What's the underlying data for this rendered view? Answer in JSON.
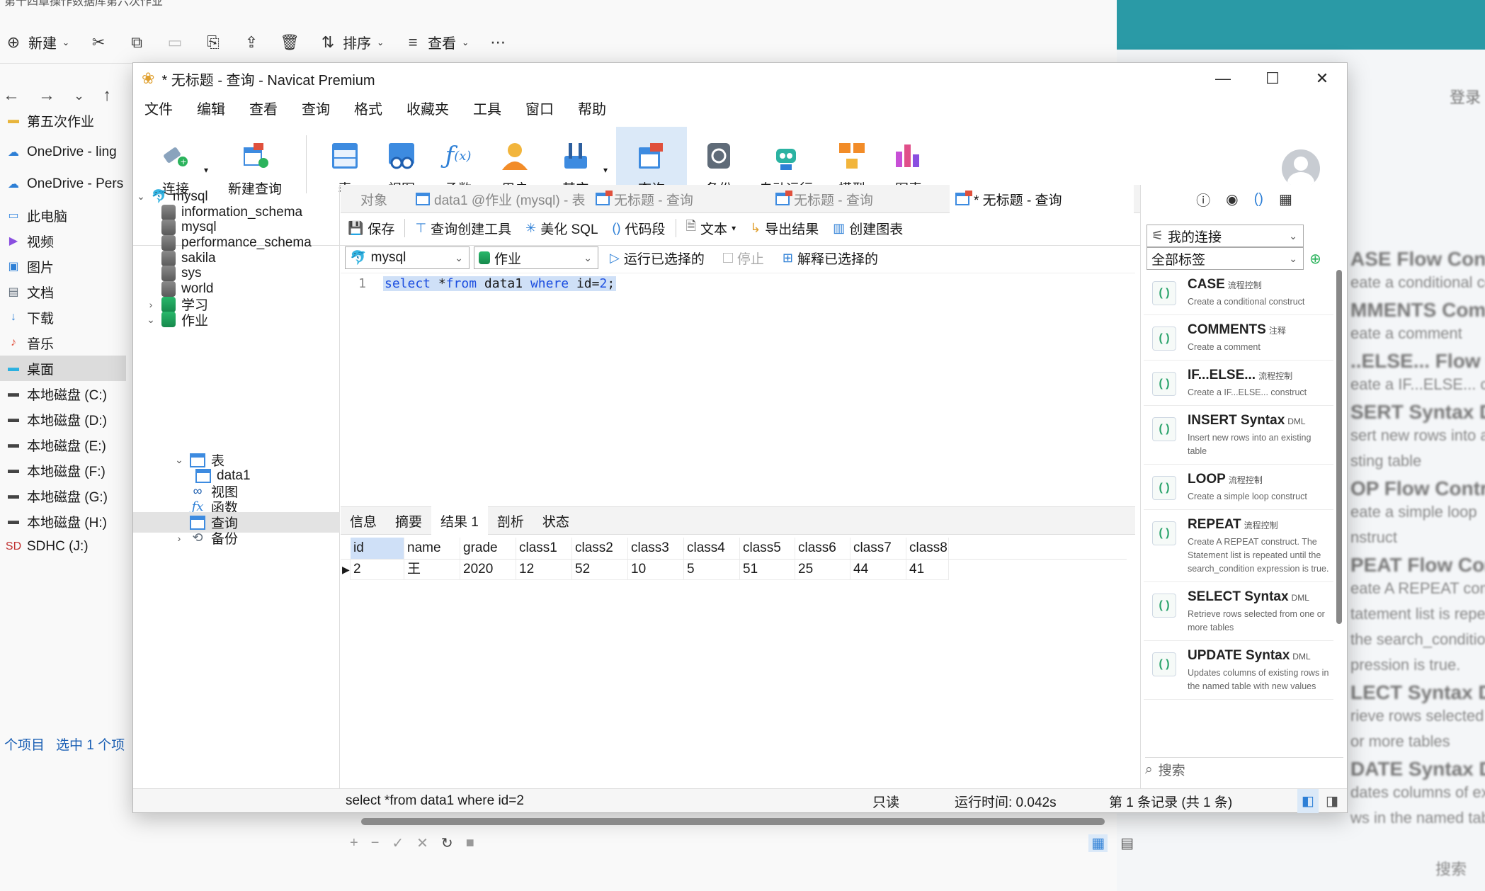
{
  "explorer": {
    "title": "第十四章操作数据库第六次作业",
    "toolbar": {
      "new_label": "新建",
      "sort_label": "排序",
      "view_label": "查看"
    },
    "sidebar": [
      {
        "label": "第五次作业",
        "icon": "folder-icon"
      },
      {
        "label": "OneDrive - ling",
        "icon": "cloud-icon"
      },
      {
        "label": "OneDrive - Pers",
        "icon": "cloud-icon"
      },
      {
        "label": "此电脑",
        "icon": "pc-icon"
      },
      {
        "label": "视频",
        "icon": "video-icon"
      },
      {
        "label": "图片",
        "icon": "picture-icon"
      },
      {
        "label": "文档",
        "icon": "document-icon"
      },
      {
        "label": "下载",
        "icon": "download-icon"
      },
      {
        "label": "音乐",
        "icon": "music-icon"
      },
      {
        "label": "桌面",
        "icon": "desktop-icon"
      },
      {
        "label": "本地磁盘 (C:)",
        "icon": "disk-icon"
      },
      {
        "label": "本地磁盘 (D:)",
        "icon": "disk-icon"
      },
      {
        "label": "本地磁盘 (E:)",
        "icon": "disk-icon"
      },
      {
        "label": "本地磁盘 (F:)",
        "icon": "disk-icon"
      },
      {
        "label": "本地磁盘 (G:)",
        "icon": "disk-icon"
      },
      {
        "label": "本地磁盘 (H:)",
        "icon": "disk-icon"
      },
      {
        "label": "SDHC (J:)",
        "icon": "sd-card-icon"
      }
    ],
    "status": {
      "items": "个项目",
      "selected": "选中 1 个项"
    }
  },
  "background_right": {
    "login_label": "登录",
    "blur_lines": [
      "ASE Flow Control",
      "eate a conditional constr",
      "MMENTS Comme",
      "eate a comment",
      "..ELSE... Flow Contro",
      "eate a IF...ELSE... constru",
      "SERT Syntax DM",
      "sert new rows into an",
      "sting table",
      "OP Flow Control",
      "eate a simple loop",
      "nstruct",
      "PEAT Flow Control",
      "eate A REPEAT construc",
      "tatement list is repeat",
      "the search_condition",
      "pression is true.",
      "LECT Syntax DML",
      "rieve rows selected fro",
      "or more tables",
      "DATE Syntax DML",
      "dates columns of existi",
      "ws in the named table wi"
    ],
    "search_label": "搜索"
  },
  "navicat": {
    "title": "* 无标题 - 查询 - Navicat Premium",
    "menu": [
      "文件",
      "编辑",
      "查看",
      "查询",
      "格式",
      "收藏夹",
      "工具",
      "窗口",
      "帮助"
    ],
    "toolbar": [
      {
        "label": "连接",
        "icon": "connection-icon"
      },
      {
        "label": "新建查询",
        "icon": "new-query-icon"
      },
      {
        "label": "表",
        "icon": "table-icon"
      },
      {
        "label": "视图",
        "icon": "view-icon"
      },
      {
        "label": "函数",
        "icon": "function-icon"
      },
      {
        "label": "用户",
        "icon": "user-icon"
      },
      {
        "label": "其它",
        "icon": "other-icon"
      },
      {
        "label": "查询",
        "icon": "query-icon"
      },
      {
        "label": "备份",
        "icon": "backup-icon"
      },
      {
        "label": "自动运行",
        "icon": "automation-icon"
      },
      {
        "label": "模型",
        "icon": "model-icon"
      },
      {
        "label": "图表",
        "icon": "chart-icon"
      }
    ],
    "tree": {
      "root": "mysql",
      "dbs": [
        "information_schema",
        "mysql",
        "performance_schema",
        "sakila",
        "sys",
        "world",
        "学习",
        "作业"
      ],
      "folder_table": "表",
      "table_data1": "data1",
      "folder_view": "视图",
      "folder_function": "函数",
      "folder_query": "查询",
      "folder_backup": "备份"
    },
    "tabs": [
      "对象",
      "data1 @作业 (mysql) - 表",
      "无标题 - 查询",
      "无标题 - 查询",
      "* 无标题 - 查询"
    ],
    "query_toolbar": {
      "save": "保存",
      "builder": "查询创建工具",
      "beautify": "美化 SQL",
      "snippet": "代码段",
      "text": "文本",
      "export": "导出结果",
      "create_chart": "创建图表"
    },
    "connection_select": "mysql",
    "database_select": "作业",
    "run_selected": "运行已选择的",
    "stop": "停止",
    "explain_selected": "解释已选择的",
    "editor": {
      "line_number": "1",
      "sql_kw1": "select",
      "sql_mid1": " *",
      "sql_kw2": "from",
      "sql_mid2": " data1 ",
      "sql_kw3": "where",
      "sql_mid3": " id=",
      "sql_num": "2",
      "sql_end": ";"
    },
    "result_tabs": [
      "信息",
      "摘要",
      "结果 1",
      "剖析",
      "状态"
    ],
    "grid": {
      "columns": [
        "id",
        "name",
        "grade",
        "class1",
        "class2",
        "class3",
        "class4",
        "class5",
        "class6",
        "class7",
        "class8"
      ],
      "rows": [
        [
          "2",
          "王",
          "2020",
          "12",
          "52",
          "10",
          "5",
          "51",
          "25",
          "44",
          "41"
        ]
      ]
    },
    "snippets": {
      "connection_select": "我的连接",
      "tag_select": "全部标签",
      "items": [
        {
          "name": "CASE",
          "tag": "流程控制",
          "desc": "Create a conditional construct"
        },
        {
          "name": "COMMENTS",
          "tag": "注释",
          "desc": "Create a comment"
        },
        {
          "name": "IF...ELSE...",
          "tag": "流程控制",
          "desc": "Create a IF...ELSE... construct"
        },
        {
          "name": "INSERT Syntax",
          "tag": "DML",
          "desc": "Insert new rows into an existing table"
        },
        {
          "name": "LOOP",
          "tag": "流程控制",
          "desc": "Create a simple loop construct"
        },
        {
          "name": "REPEAT",
          "tag": "流程控制",
          "desc": "Create A REPEAT construct. The Statement list is repeated until the search_condition expression is true."
        },
        {
          "name": "SELECT Syntax",
          "tag": "DML",
          "desc": "Retrieve rows selected from one or more tables"
        },
        {
          "name": "UPDATE Syntax",
          "tag": "DML",
          "desc": "Updates columns of existing rows in the named table with new values"
        }
      ],
      "search_placeholder": "搜索"
    },
    "status": {
      "sql": "select *from data1 where id=2",
      "readonly": "只读",
      "runtime": "运行时间: 0.042s",
      "records": "第 1 条记录 (共 1 条)"
    },
    "colors": {
      "accent": "#2d7fd6",
      "active_tab_bg": "#dbe9f8",
      "teal": "#2a9aa6"
    }
  }
}
